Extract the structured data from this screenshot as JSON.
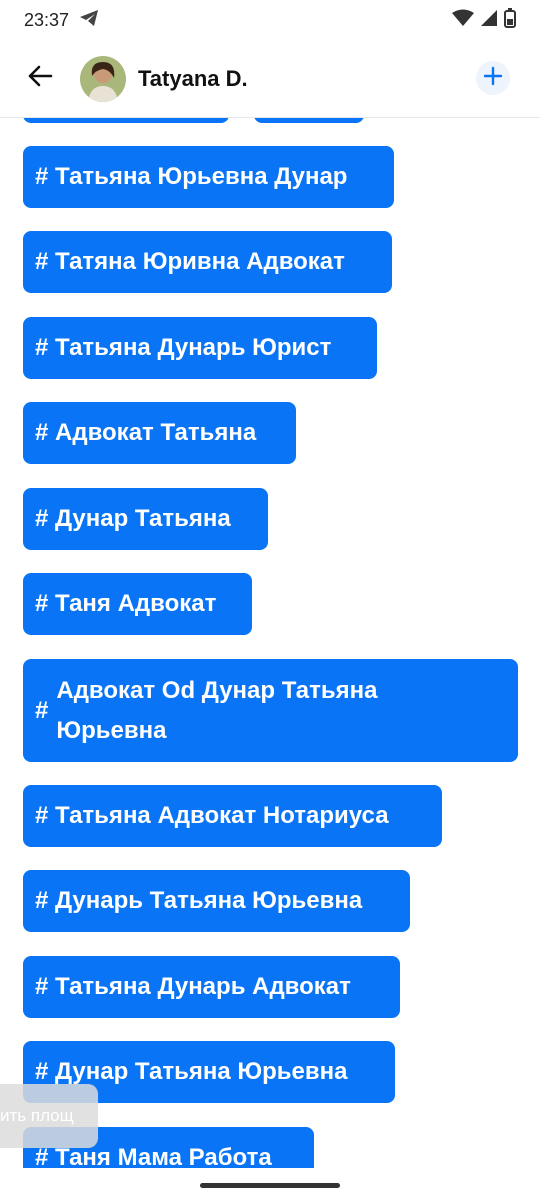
{
  "status": {
    "time": "23:37",
    "app_icon": "telegram-icon",
    "icons": [
      "wifi-icon",
      "signal-icon",
      "battery-icon"
    ]
  },
  "header": {
    "title": "Tatyana D.",
    "back_icon": "arrow-left-icon",
    "add_icon": "plus-icon"
  },
  "colors": {
    "chip_bg": "#0a74f6",
    "accent": "#0a74f6"
  },
  "tags": [
    "# Татьяна Юрьевна Дунар",
    "# Татяна Юривна Адвокат",
    "# Татьяна Дунарь Юрист",
    "# Адвокат Татьяна",
    "# Дунар Татьяна",
    "# Таня Адвокат",
    "Адвокат Od Дунар Татьяна Юрьевна",
    "# Татьяна Адвокат Нотариуса",
    "# Дунарь Татьяна Юрьевна",
    "# Татьяна Дунарь Адвокат",
    "# Дунар Татьяна Юрьевна",
    "# Таня Мама Работа"
  ],
  "multi_hash": "#",
  "toast": "ить площ"
}
